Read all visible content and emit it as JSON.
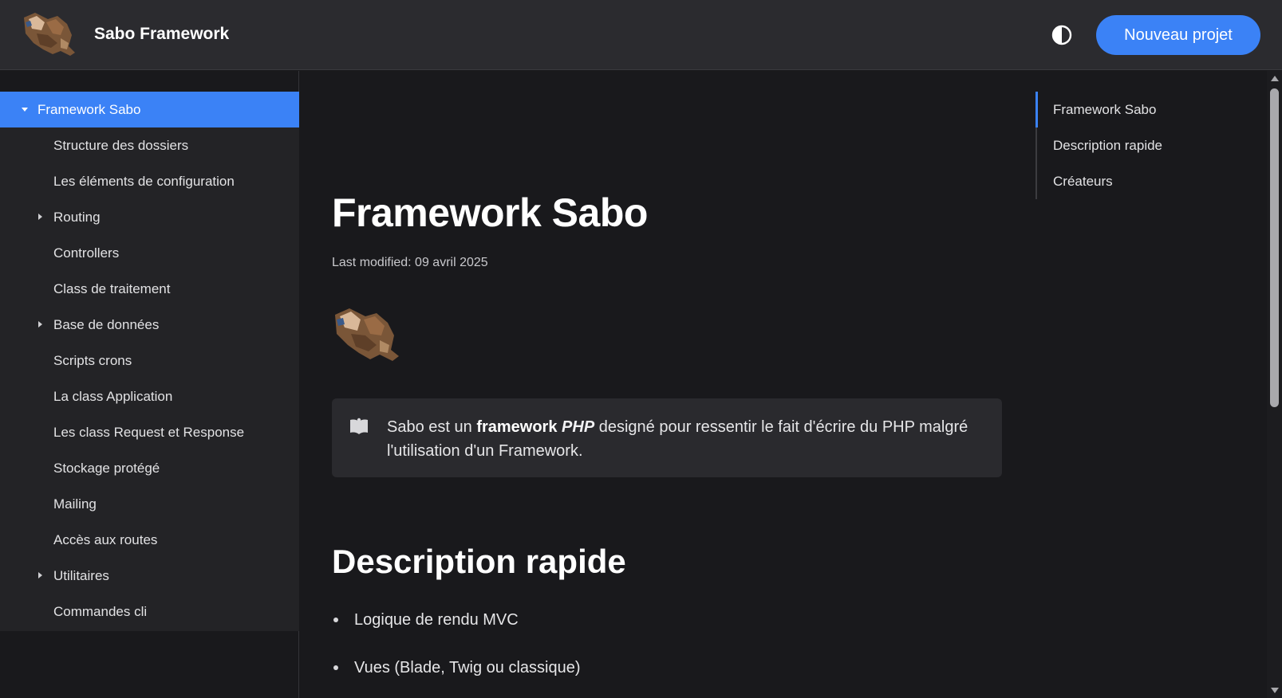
{
  "header": {
    "brand_name": "Sabo Framework",
    "new_project_label": "Nouveau projet",
    "theme_toggle_icon": "contrast-icon"
  },
  "sidebar": {
    "items": [
      {
        "label": "Framework Sabo",
        "active": true,
        "expandable": true,
        "expanded": true
      },
      {
        "label": "Structure des dossiers"
      },
      {
        "label": "Les éléments de configuration"
      },
      {
        "label": "Routing",
        "expandable": true
      },
      {
        "label": "Controllers"
      },
      {
        "label": "Class de traitement"
      },
      {
        "label": "Base de données",
        "expandable": true
      },
      {
        "label": "Scripts crons"
      },
      {
        "label": "La class Application"
      },
      {
        "label": "Les class Request et Response"
      },
      {
        "label": "Stockage protégé"
      },
      {
        "label": "Mailing"
      },
      {
        "label": "Accès aux routes"
      },
      {
        "label": "Utilitaires",
        "expandable": true
      },
      {
        "label": "Commandes cli"
      }
    ]
  },
  "main": {
    "title": "Framework Sabo",
    "last_modified": "Last modified: 09 avril 2025",
    "callout": {
      "icon": "book-icon",
      "text_before": "Sabo est un ",
      "text_bold": "framework",
      "text_italic": "PHP",
      "text_after": " designé pour ressentir le fait d'écrire du PHP malgré l'utilisation d'un Framework."
    },
    "section_title": "Description rapide",
    "bullets": [
      "Logique de rendu MVC",
      "Vues (Blade, Twig ou classique)"
    ]
  },
  "toc": {
    "items": [
      {
        "label": "Framework Sabo",
        "active": true
      },
      {
        "label": "Description rapide"
      },
      {
        "label": "Créateurs"
      }
    ]
  },
  "colors": {
    "accent": "#3b82f6",
    "header_bg": "#2b2b2f",
    "page_bg": "#19191c",
    "sidebar_list_bg": "#232326",
    "callout_bg": "#2a2a2e"
  }
}
